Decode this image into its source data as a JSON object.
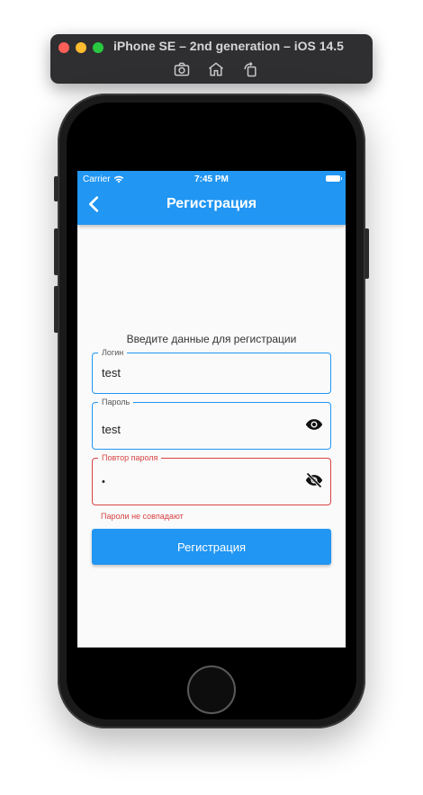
{
  "simulator": {
    "title": "iPhone SE – 2nd generation – iOS 14.5",
    "toolbar": {
      "screenshot_icon": "camera-icon",
      "home_icon": "home-icon",
      "rotate_icon": "rotate-icon"
    }
  },
  "status_bar": {
    "carrier": "Carrier",
    "time": "7:45 PM"
  },
  "app_bar": {
    "title": "Регистрация",
    "back_icon": "chevron-left-icon"
  },
  "form": {
    "prompt": "Введите данные для регистрации",
    "login": {
      "label": "Логин",
      "value": "test"
    },
    "password": {
      "label": "Пароль",
      "value": "test",
      "icon": "eye-icon"
    },
    "repeat_password": {
      "label": "Повтор пароля",
      "value": "•",
      "icon": "eye-off-icon"
    },
    "error": "Пароли не совпадают",
    "submit_label": "Регистрация"
  },
  "colors": {
    "primary": "#2196f3",
    "error": "#d84343",
    "background": "#fafafa"
  }
}
